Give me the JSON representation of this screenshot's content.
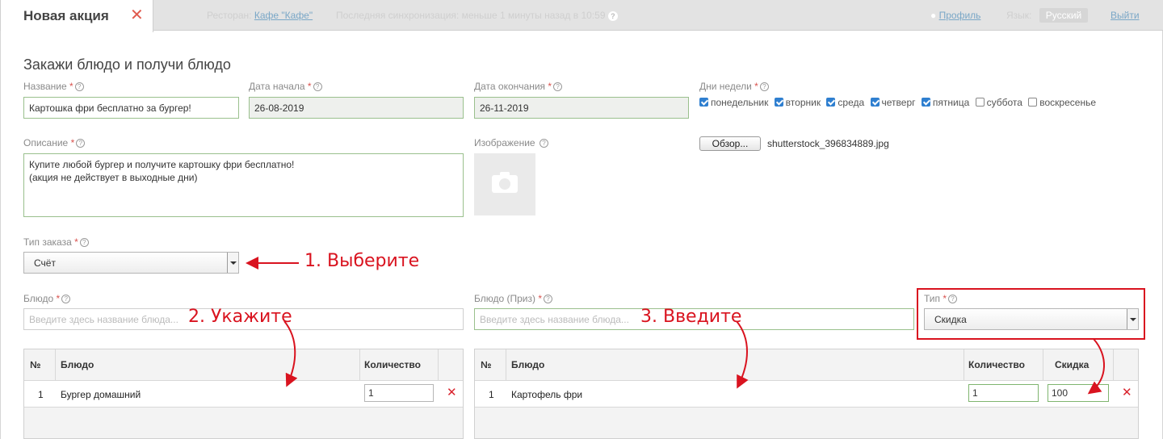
{
  "tab": {
    "title": "Новая акция"
  },
  "topbar": {
    "restaurant_label": "Ресторан:",
    "restaurant_name": "Кафе \"Кафе\"",
    "sync_text": "Последняя синхронизация: меньше 1 минуты назад в 10:59",
    "profile": "Профиль",
    "language_label": "Язык:",
    "language_value": "Русский",
    "logout": "Выйти"
  },
  "page_title": "Закажи блюдо и получи блюдо",
  "form": {
    "name": {
      "label": "Название",
      "value": "Картошка фри бесплатно за бургер!"
    },
    "start_date": {
      "label": "Дата начала",
      "value": "26-08-2019"
    },
    "end_date": {
      "label": "Дата окончания",
      "value": "26-11-2019"
    },
    "weekdays": {
      "label": "Дни недели",
      "items": [
        {
          "label": "понедельник",
          "checked": true
        },
        {
          "label": "вторник",
          "checked": true
        },
        {
          "label": "среда",
          "checked": true
        },
        {
          "label": "четверг",
          "checked": true
        },
        {
          "label": "пятница",
          "checked": true
        },
        {
          "label": "суббота",
          "checked": false
        },
        {
          "label": "воскресенье",
          "checked": false
        }
      ]
    },
    "description": {
      "label": "Описание",
      "value": "Купите любой бургер и получите картошку фри бесплатно!\n(акция не действует в выходные дни)"
    },
    "image": {
      "label": "Изображение",
      "browse": "Обзор...",
      "filename": "shutterstock_396834889.jpg"
    },
    "order_type": {
      "label": "Тип заказа",
      "value": "Счёт"
    },
    "dish": {
      "label": "Блюдо",
      "placeholder": "Введите здесь название блюда..."
    },
    "prize_dish": {
      "label": "Блюдо (Приз)",
      "placeholder": "Введите здесь название блюда..."
    },
    "type": {
      "label": "Тип",
      "value": "Скидка"
    }
  },
  "left_table": {
    "headers": [
      "№",
      "Блюдо",
      "Количество"
    ],
    "rows": [
      {
        "num": "1",
        "dish": "Бургер домашний",
        "qty": "1"
      }
    ]
  },
  "right_table": {
    "headers": [
      "№",
      "Блюдо",
      "Количество",
      "Скидка"
    ],
    "rows": [
      {
        "num": "1",
        "dish": "Картофель фри",
        "qty": "1",
        "discount": "100"
      }
    ]
  },
  "annotations": {
    "step1": "1. Выберите",
    "step2": "2. Укажите",
    "step3": "3. Введите"
  },
  "colors": {
    "annotation": "#d9131f",
    "field_border": "#9ac08d",
    "checkbox": "#2f7fd0"
  }
}
